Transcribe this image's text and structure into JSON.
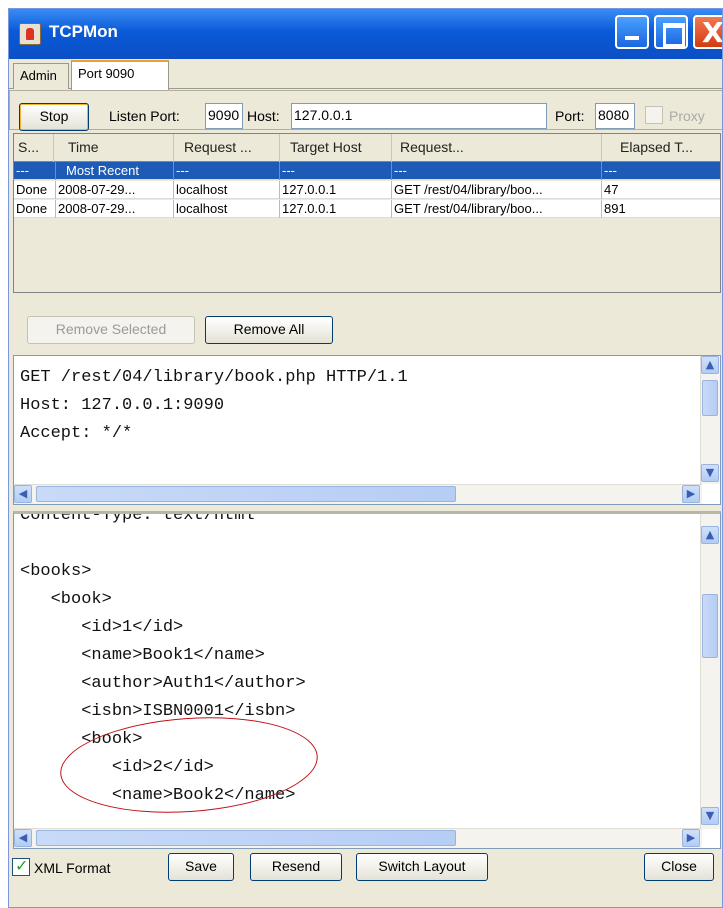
{
  "window": {
    "title": "TCPMon",
    "close_glyph": "X"
  },
  "tabs": [
    {
      "label": "Admin"
    },
    {
      "label": "Port 9090"
    }
  ],
  "controls": {
    "stop_label": "Stop",
    "listen_port_label": "Listen Port:",
    "listen_port_value": "9090",
    "host_label": "Host:",
    "host_value": "127.0.0.1",
    "port_label": "Port:",
    "port_value": "8080",
    "proxy_label": "Proxy"
  },
  "table": {
    "columns": [
      "S...",
      "Time",
      "Request ...",
      "Target Host",
      "Request...",
      "Elapsed T..."
    ],
    "rows": [
      [
        "---",
        "Most Recent",
        "---",
        "---",
        "---",
        "---"
      ],
      [
        "Done",
        "2008-07-29...",
        "localhost",
        "127.0.0.1",
        "GET /rest/04/library/boo...",
        "47"
      ],
      [
        "Done",
        "2008-07-29...",
        "localhost",
        "127.0.0.1",
        "GET /rest/04/library/boo...",
        "891"
      ]
    ]
  },
  "buttons": {
    "remove_selected": "Remove Selected",
    "remove_all": "Remove All"
  },
  "request_lines": [
    "GET /rest/04/library/book.php HTTP/1.1",
    "Host: 127.0.0.1:9090",
    "Accept: */*"
  ],
  "response_lines": [
    "Content-Type: text/html",
    "",
    "<books>",
    "   <book>",
    "      <id>1</id>",
    "      <name>Book1</name>",
    "      <author>Auth1</author>",
    "      <isbn>ISBN0001</isbn>",
    "      <book>",
    "         <id>2</id>",
    "         <name>Book2</name>"
  ],
  "footer": {
    "xml_format_label": "XML Format",
    "xml_format_checked": true,
    "save": "Save",
    "resend": "Resend",
    "switch_layout": "Switch Layout",
    "close": "Close"
  },
  "colors": {
    "title_bar": "#0b4fc4",
    "selection": "#1e5bb6",
    "annotation": "#c0121a"
  }
}
